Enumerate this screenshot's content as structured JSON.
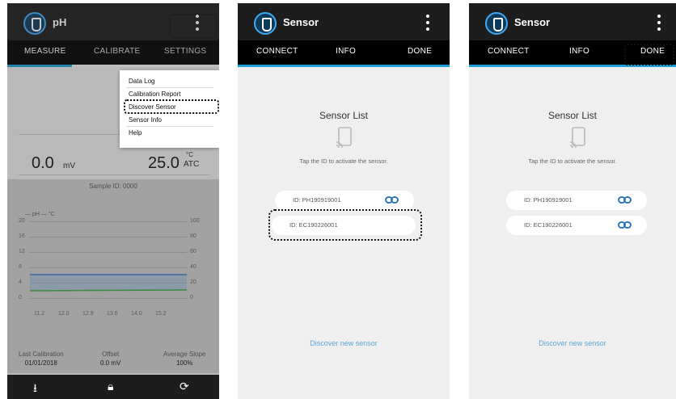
{
  "screen1": {
    "title": "pH",
    "tabs": [
      "MEASURE",
      "CALIBRATE",
      "SETTINGS"
    ],
    "menu_items": [
      "Data Log",
      "Calibration Report",
      "Discover Sensor",
      "Sensor Info",
      "Help"
    ],
    "mv_value": "0.0",
    "mv_unit": "mV",
    "temp_value": "25.0",
    "temp_unit_top": "°C",
    "temp_unit_bottom": "ATC",
    "sample_id": "Sample ID: 0000",
    "legend": "— pH — °C",
    "y_left": [
      "20",
      "16",
      "12",
      "8",
      "4",
      "0"
    ],
    "y_right": [
      "100",
      "80",
      "60",
      "40",
      "20",
      "0"
    ],
    "x_labels": [
      "11.2",
      "12.0",
      "12.9",
      "13.6",
      "14.0",
      "15.2"
    ],
    "last_calibration_label": "Last Calibration",
    "last_calibration_value": "01/01/2018",
    "offset_label": "Offset",
    "offset_value": "0.0 mV",
    "slope_label": "Average Slope",
    "slope_value": "100%",
    "bottom_icons": [
      "download-icon",
      "lock-icon",
      "refresh-icon"
    ]
  },
  "screen2": {
    "title": "Sensor",
    "tabs": [
      "CONNECT",
      "INFO",
      "DONE"
    ],
    "list_title": "Sensor List",
    "hint": "Tap the ID to activate the sensor.",
    "sensors": [
      {
        "id": "ID: PH190919001",
        "linked": true
      },
      {
        "id": "ID: EC190226001",
        "linked": false
      }
    ],
    "discover": "Discover new sensor"
  },
  "screen3": {
    "title": "Sensor",
    "tabs": [
      "CONNECT",
      "INFO",
      "DONE"
    ],
    "list_title": "Sensor List",
    "hint": "Tap the ID to activate the sensor.",
    "sensors": [
      {
        "id": "ID: PH190919001",
        "linked": true
      },
      {
        "id": "ID: EC190226001",
        "linked": true
      }
    ],
    "discover": "Discover new sensor"
  },
  "colors": {
    "header": "#1d1d1d",
    "tab_bar": "#000000",
    "accent": "#1d9fd4",
    "link_text": "#5aa7d6",
    "ph_line": "#3b78c4",
    "temp_line": "#3aa83a"
  }
}
